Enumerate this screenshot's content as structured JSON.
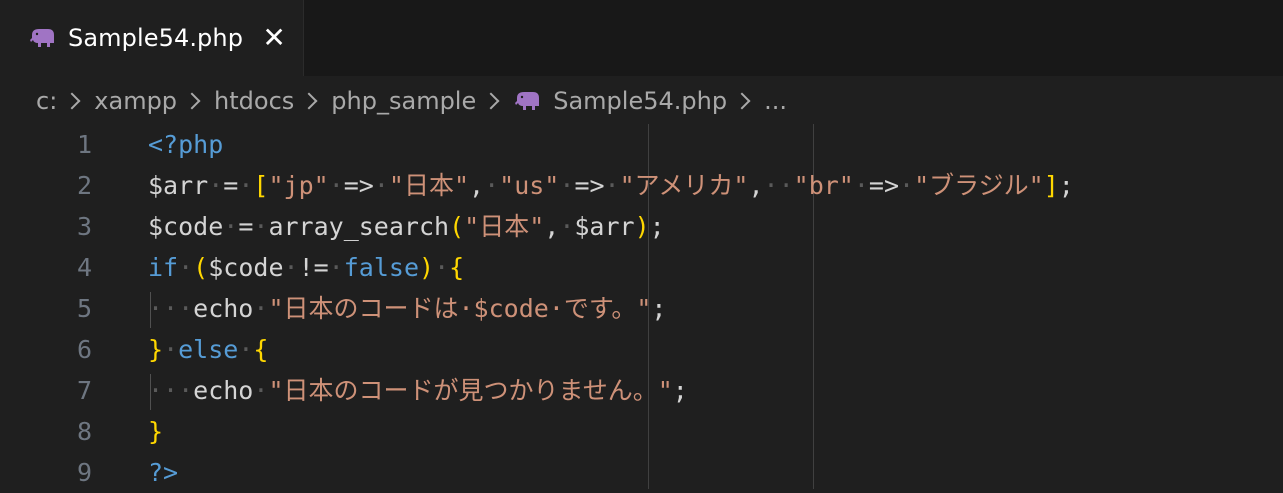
{
  "tab": {
    "title": "Sample54.php",
    "close": "✕"
  },
  "breadcrumb": [
    "c:",
    "xampp",
    "htdocs",
    "php_sample",
    "Sample54.php",
    "..."
  ],
  "lines": [
    {
      "n": "1",
      "tokens": [
        {
          "t": "<?php",
          "c": "kw"
        }
      ]
    },
    {
      "n": "2",
      "tokens": [
        {
          "t": "$arr",
          "c": "var"
        },
        {
          "t": "·",
          "c": "ws"
        },
        {
          "t": "=",
          "c": "op"
        },
        {
          "t": "·",
          "c": "ws"
        },
        {
          "t": "[",
          "c": "br1"
        },
        {
          "t": "\"jp\"",
          "c": "str"
        },
        {
          "t": "·",
          "c": "ws"
        },
        {
          "t": "=>",
          "c": "op"
        },
        {
          "t": "·",
          "c": "ws"
        },
        {
          "t": "\"日本\"",
          "c": "str"
        },
        {
          "t": ",",
          "c": "op"
        },
        {
          "t": "·",
          "c": "ws"
        },
        {
          "t": "\"us\"",
          "c": "str"
        },
        {
          "t": "·",
          "c": "ws"
        },
        {
          "t": "=>",
          "c": "op"
        },
        {
          "t": "·",
          "c": "ws"
        },
        {
          "t": "\"アメリカ\"",
          "c": "str"
        },
        {
          "t": ",",
          "c": "op"
        },
        {
          "t": "··",
          "c": "ws"
        },
        {
          "t": "\"br\"",
          "c": "str"
        },
        {
          "t": "·",
          "c": "ws"
        },
        {
          "t": "=>",
          "c": "op"
        },
        {
          "t": "·",
          "c": "ws"
        },
        {
          "t": "\"ブラジル\"",
          "c": "str"
        },
        {
          "t": "]",
          "c": "br1"
        },
        {
          "t": ";",
          "c": "op"
        }
      ]
    },
    {
      "n": "3",
      "tokens": [
        {
          "t": "$code",
          "c": "var"
        },
        {
          "t": "·",
          "c": "ws"
        },
        {
          "t": "=",
          "c": "op"
        },
        {
          "t": "·",
          "c": "ws"
        },
        {
          "t": "array_search",
          "c": "op"
        },
        {
          "t": "(",
          "c": "br1"
        },
        {
          "t": "\"日本\"",
          "c": "str"
        },
        {
          "t": ",",
          "c": "op"
        },
        {
          "t": "·",
          "c": "ws"
        },
        {
          "t": "$arr",
          "c": "var"
        },
        {
          "t": ")",
          "c": "br1"
        },
        {
          "t": ";",
          "c": "op"
        }
      ]
    },
    {
      "n": "4",
      "tokens": [
        {
          "t": "if",
          "c": "kw"
        },
        {
          "t": "·",
          "c": "ws"
        },
        {
          "t": "(",
          "c": "br1"
        },
        {
          "t": "$code",
          "c": "var"
        },
        {
          "t": "·",
          "c": "ws"
        },
        {
          "t": "!=",
          "c": "op"
        },
        {
          "t": "·",
          "c": "ws"
        },
        {
          "t": "false",
          "c": "kw"
        },
        {
          "t": ")",
          "c": "br1"
        },
        {
          "t": "·",
          "c": "ws"
        },
        {
          "t": "{",
          "c": "br1"
        }
      ]
    },
    {
      "n": "5",
      "tokens": [
        {
          "t": "···",
          "c": "ws"
        },
        {
          "t": "echo",
          "c": "op"
        },
        {
          "t": "·",
          "c": "ws"
        },
        {
          "t": "\"日本のコードは·",
          "c": "str"
        },
        {
          "t": "$code",
          "c": "str"
        },
        {
          "t": "·です。\"",
          "c": "str"
        },
        {
          "t": ";",
          "c": "op"
        }
      ]
    },
    {
      "n": "6",
      "tokens": [
        {
          "t": "}",
          "c": "br1"
        },
        {
          "t": "·",
          "c": "ws"
        },
        {
          "t": "else",
          "c": "kw"
        },
        {
          "t": "·",
          "c": "ws"
        },
        {
          "t": "{",
          "c": "br1"
        }
      ]
    },
    {
      "n": "7",
      "tokens": [
        {
          "t": "···",
          "c": "ws"
        },
        {
          "t": "echo",
          "c": "op"
        },
        {
          "t": "·",
          "c": "ws"
        },
        {
          "t": "\"日本のコードが見つかりません。\"",
          "c": "str"
        },
        {
          "t": ";",
          "c": "op"
        }
      ]
    },
    {
      "n": "8",
      "tokens": [
        {
          "t": "}",
          "c": "br1"
        }
      ]
    },
    {
      "n": "9",
      "tokens": [
        {
          "t": "?>",
          "c": "kw"
        }
      ]
    }
  ],
  "colors": {
    "background": "#1f1f1f",
    "tabbar": "#181818",
    "keyword": "#569cd6",
    "string": "#ce9178",
    "bracket": "#ffd700",
    "php_icon": "#a074c4"
  }
}
